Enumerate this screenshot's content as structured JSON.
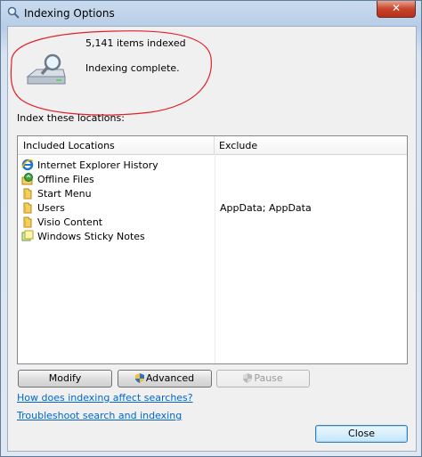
{
  "window": {
    "title": "Indexing Options",
    "close_label": "✕"
  },
  "status": {
    "items_indexed": "5,141 items indexed",
    "state": "Indexing complete."
  },
  "locations": {
    "caption": "Index these locations:",
    "columns": {
      "included": "Included Locations",
      "exclude": "Exclude"
    },
    "rows": [
      {
        "name": "Internet Explorer History",
        "exclude": "",
        "icon": "internet-explorer-icon"
      },
      {
        "name": "Offline Files",
        "exclude": "",
        "icon": "offline-files-icon"
      },
      {
        "name": "Start Menu",
        "exclude": "",
        "icon": "folder-icon"
      },
      {
        "name": "Users",
        "exclude": "AppData; AppData",
        "icon": "folder-icon"
      },
      {
        "name": "Visio Content",
        "exclude": "",
        "icon": "folder-icon"
      },
      {
        "name": "Windows Sticky Notes",
        "exclude": "",
        "icon": "sticky-notes-icon"
      }
    ]
  },
  "buttons": {
    "modify": "Modify",
    "advanced": "Advanced",
    "pause": "Pause",
    "close": "Close"
  },
  "links": {
    "how_indexing": "How does indexing affect searches?",
    "troubleshoot": "Troubleshoot search and indexing"
  },
  "colors": {
    "annotation": "#e0202a",
    "link": "#0066cc"
  }
}
